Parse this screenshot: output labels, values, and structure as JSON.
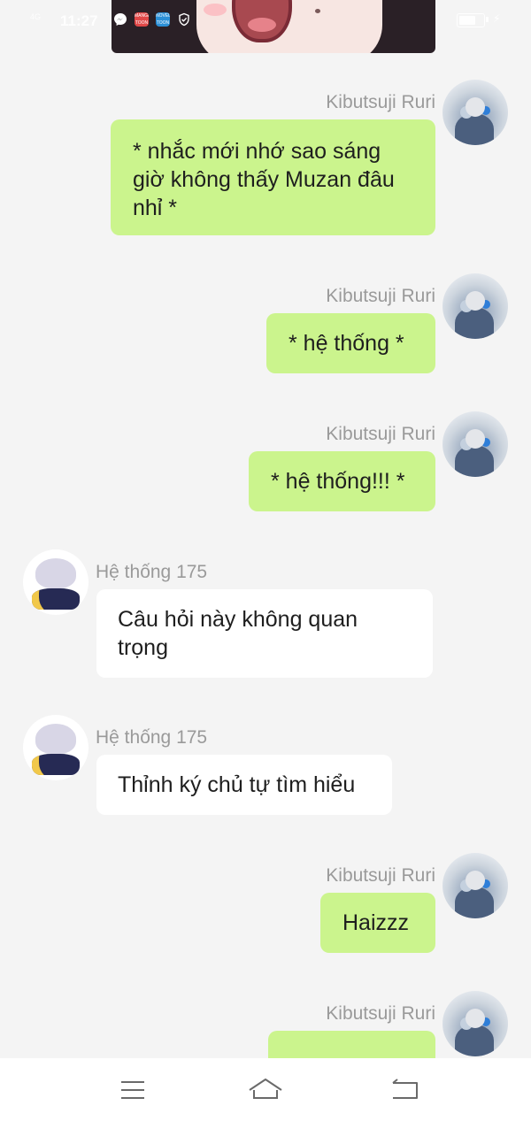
{
  "status_bar": {
    "signal": "4G",
    "time": "11:27",
    "battery_level": 0.6,
    "icons": [
      "messenger-icon",
      "mangatoon-app-icon",
      "noveltoon-app-icon",
      "shield-icon",
      "battery-icon",
      "charging-icon"
    ],
    "app_icon_labels": {
      "mangatoon": "MANGA TOON",
      "noveltoon": "NOVEL TOON"
    }
  },
  "colors": {
    "background": "#f4f4f4",
    "outgoing_bubble": "#cbf48d",
    "incoming_bubble": "#ffffff",
    "sender_text": "#9a9a9a",
    "message_text": "#1e1e1e"
  },
  "messages": [
    {
      "sender": "Kibutsuji Ruri",
      "side": "right",
      "text": "* nhắc mới nhớ sao sáng giờ không thấy Muzan đâu nhỉ *"
    },
    {
      "sender": "Kibutsuji Ruri",
      "side": "right",
      "text": "* hệ thống *"
    },
    {
      "sender": "Kibutsuji Ruri",
      "side": "right",
      "text": "* hệ thống!!! *"
    },
    {
      "sender": "Hệ thống 175",
      "side": "left",
      "text": "Câu hỏi này không quan trọng"
    },
    {
      "sender": "Hệ thống 175",
      "side": "left",
      "text": "Thỉnh ký chủ tự tìm hiểu"
    },
    {
      "sender": "Kibutsuji Ruri",
      "side": "right",
      "text": "Haizzz"
    },
    {
      "sender": "Kibutsuji Ruri",
      "side": "right",
      "text": ""
    }
  ],
  "navigation": {
    "icons": [
      "menu-icon",
      "home-icon",
      "back-icon"
    ]
  }
}
